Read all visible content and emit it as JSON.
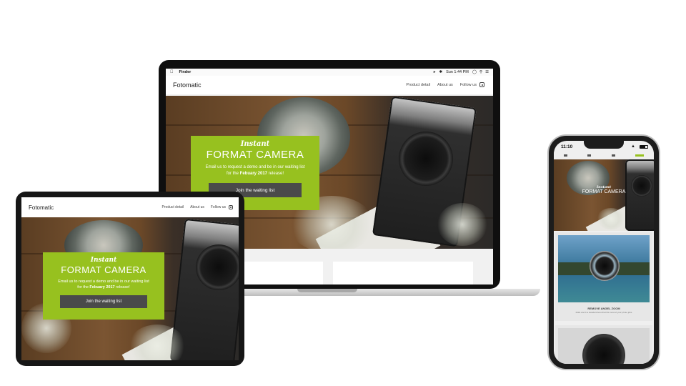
{
  "site": {
    "brand": "Fotomatic",
    "nav": [
      "Product detail",
      "About us",
      "Follow us"
    ]
  },
  "promo": {
    "script": "Instant",
    "title": "FORMAT CAMERA",
    "body_prefix": "Email us to request a demo and be in our waiting list for the ",
    "body_strong": "Febuary 2017",
    "body_suffix": " release!",
    "cta": "Join the waiting list"
  },
  "mac_menubar": {
    "app": "Finder",
    "clock": "Sun 1:44 PM"
  },
  "phone": {
    "time": "11:10",
    "card_caption": "REMOVE ANGEL ZOOM",
    "card_subcaption": "Rolls and it a standard lens that fits most of your photo jobs"
  },
  "colors": {
    "accent": "#97c11f",
    "cta": "#4a4a4a",
    "device_frame": "#161616"
  }
}
